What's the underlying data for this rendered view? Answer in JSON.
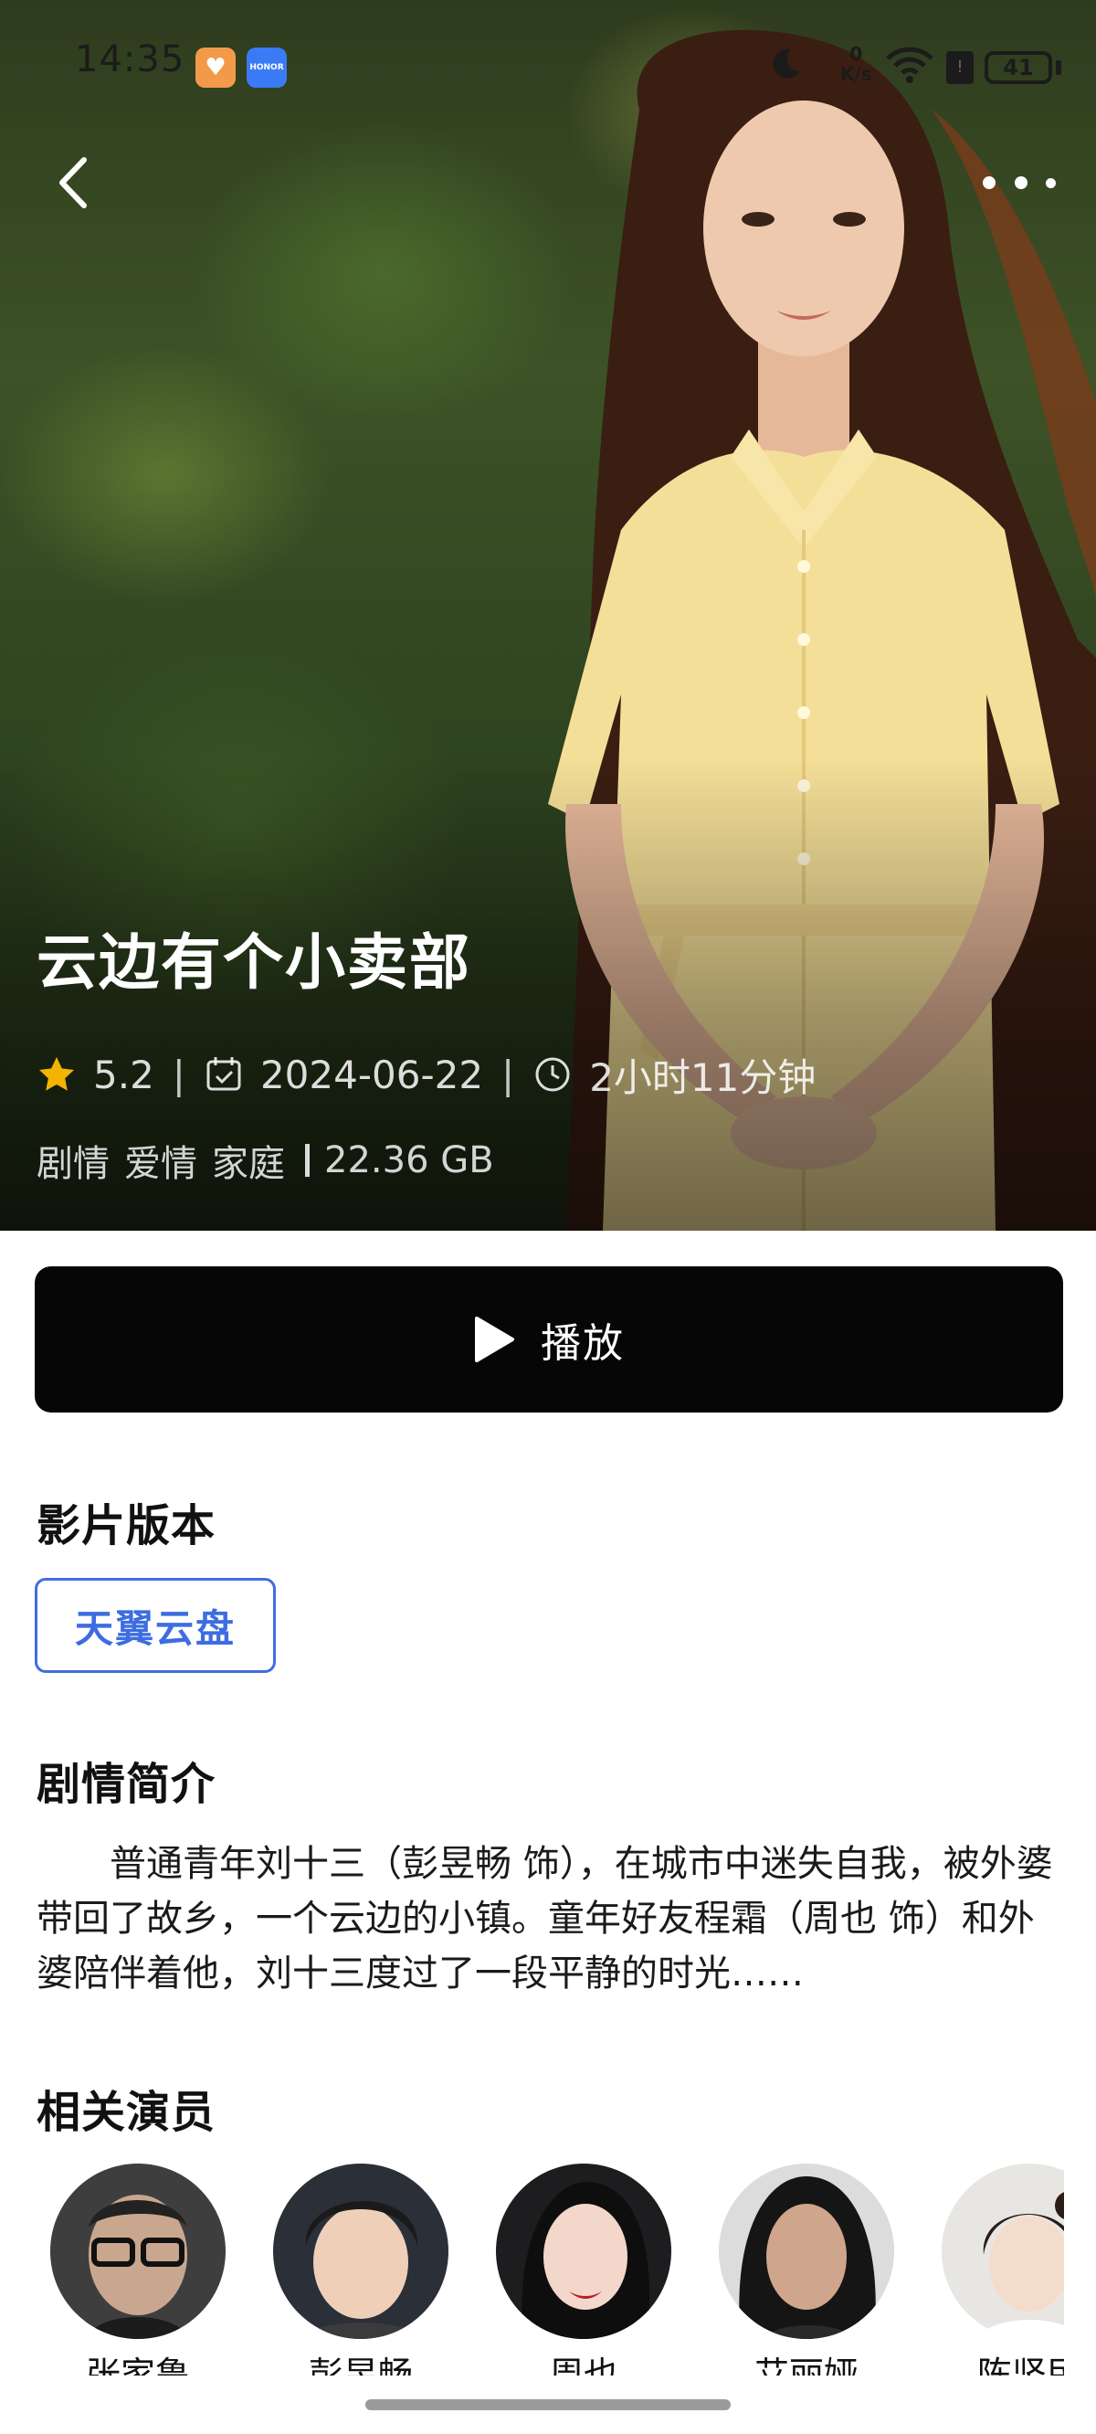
{
  "status_bar": {
    "time": "14:35",
    "net_speed_value": "0",
    "net_speed_unit": "K/s",
    "battery": "41",
    "app_badges": [
      "health-heart-icon",
      "honor-app-icon"
    ],
    "honor_label": "HONOR"
  },
  "nav": {
    "back_icon": "chevron-left-icon",
    "more_icon": "more-dots-icon"
  },
  "movie": {
    "title": "云边有个小卖部",
    "rating": "5.2",
    "release_date": "2024-06-22",
    "duration": "2小时11分钟",
    "genres": [
      "剧情",
      "爱情",
      "家庭"
    ],
    "file_size": "22.36 GB",
    "separator": "|"
  },
  "play_button": {
    "label": "播放",
    "icon": "play-icon"
  },
  "versions": {
    "title": "影片版本",
    "items": [
      "天翼云盘"
    ],
    "accent_color": "#3d6de0"
  },
  "synopsis": {
    "title": "剧情简介",
    "text": "普通青年刘十三（彭昱畅 饰），在城市中迷失自我，被外婆带回了故乡，一个云边的小镇。童年好友程霜（周也 饰）和外婆陪伴着他，刘十三度过了一段平静的时光……"
  },
  "cast": {
    "title": "相关演员",
    "members": [
      {
        "name": "张家鲁"
      },
      {
        "name": "彭昱畅"
      },
      {
        "name": "周也"
      },
      {
        "name": "艾丽娅"
      },
      {
        "name": "陈竖民"
      }
    ]
  },
  "colors": {
    "play_button_bg": "#060606",
    "star": "#f2b400"
  }
}
